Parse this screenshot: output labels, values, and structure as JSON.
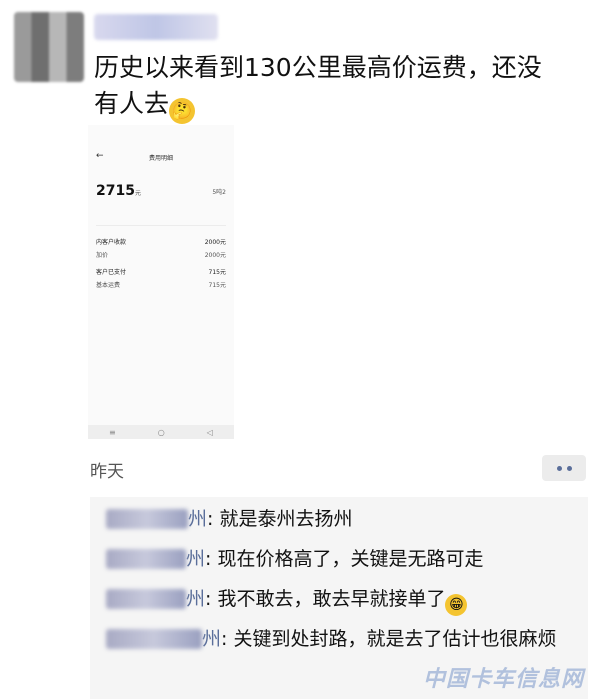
{
  "post": {
    "text": "历史以来看到130公里最高价运费，还没有人去",
    "emoji": "🤔"
  },
  "screenshot": {
    "title": "费用明细",
    "amount": "2715",
    "amount_unit": "元",
    "right_value": "5吨2",
    "inner_label": "内客户收款",
    "inner_value": "2000元",
    "sub_label": "加价",
    "sub_value": "2000元",
    "paid_label": "客户已支付",
    "paid_value": "715元",
    "base_label": "基本运费",
    "base_value": "715元"
  },
  "timestamp": "昨天",
  "comments": [
    {
      "name_tail": "州",
      "text": ": 就是泰州去扬州",
      "emoji": ""
    },
    {
      "name_tail": "州",
      "text": ": 现在价格高了，关键是无路可走",
      "emoji": ""
    },
    {
      "name_tail": "州",
      "text": ": 我不敢去，敢去早就接单了",
      "emoji": "😁"
    },
    {
      "name_tail": "州",
      "text": ": 关键到处封路，就是去了估计也很麻烦",
      "emoji": ""
    }
  ],
  "watermark": "中国卡车信息网"
}
